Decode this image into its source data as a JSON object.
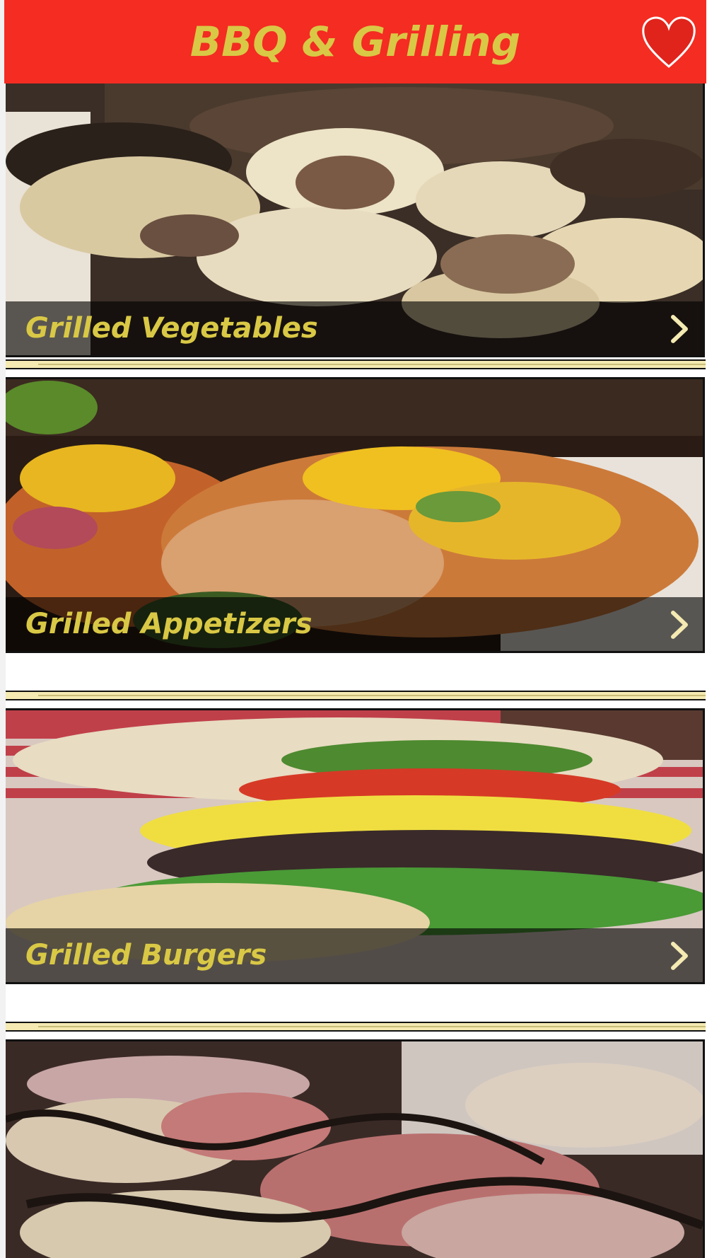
{
  "header": {
    "title": "BBQ & Grilling",
    "favorite_icon": "heart-icon"
  },
  "categories": [
    {
      "label": "Grilled Vegetables",
      "image": "grilled-potatoes-mushrooms-photo",
      "chevron_icon": "chevron-right-icon"
    },
    {
      "label": "Grilled Appetizers",
      "image": "fish-cakes-mango-salsa-photo",
      "chevron_icon": "chevron-right-icon"
    },
    {
      "label": "Grilled Burgers",
      "image": "cheeseburger-photo",
      "chevron_icon": "chevron-right-icon"
    },
    {
      "label": "",
      "image": "grilled-onions-flatbread-photo",
      "chevron_icon": ""
    }
  ],
  "colors": {
    "header_bg": "#f42c22",
    "accent_text": "#d9c845",
    "divider": "#f4eab2"
  }
}
